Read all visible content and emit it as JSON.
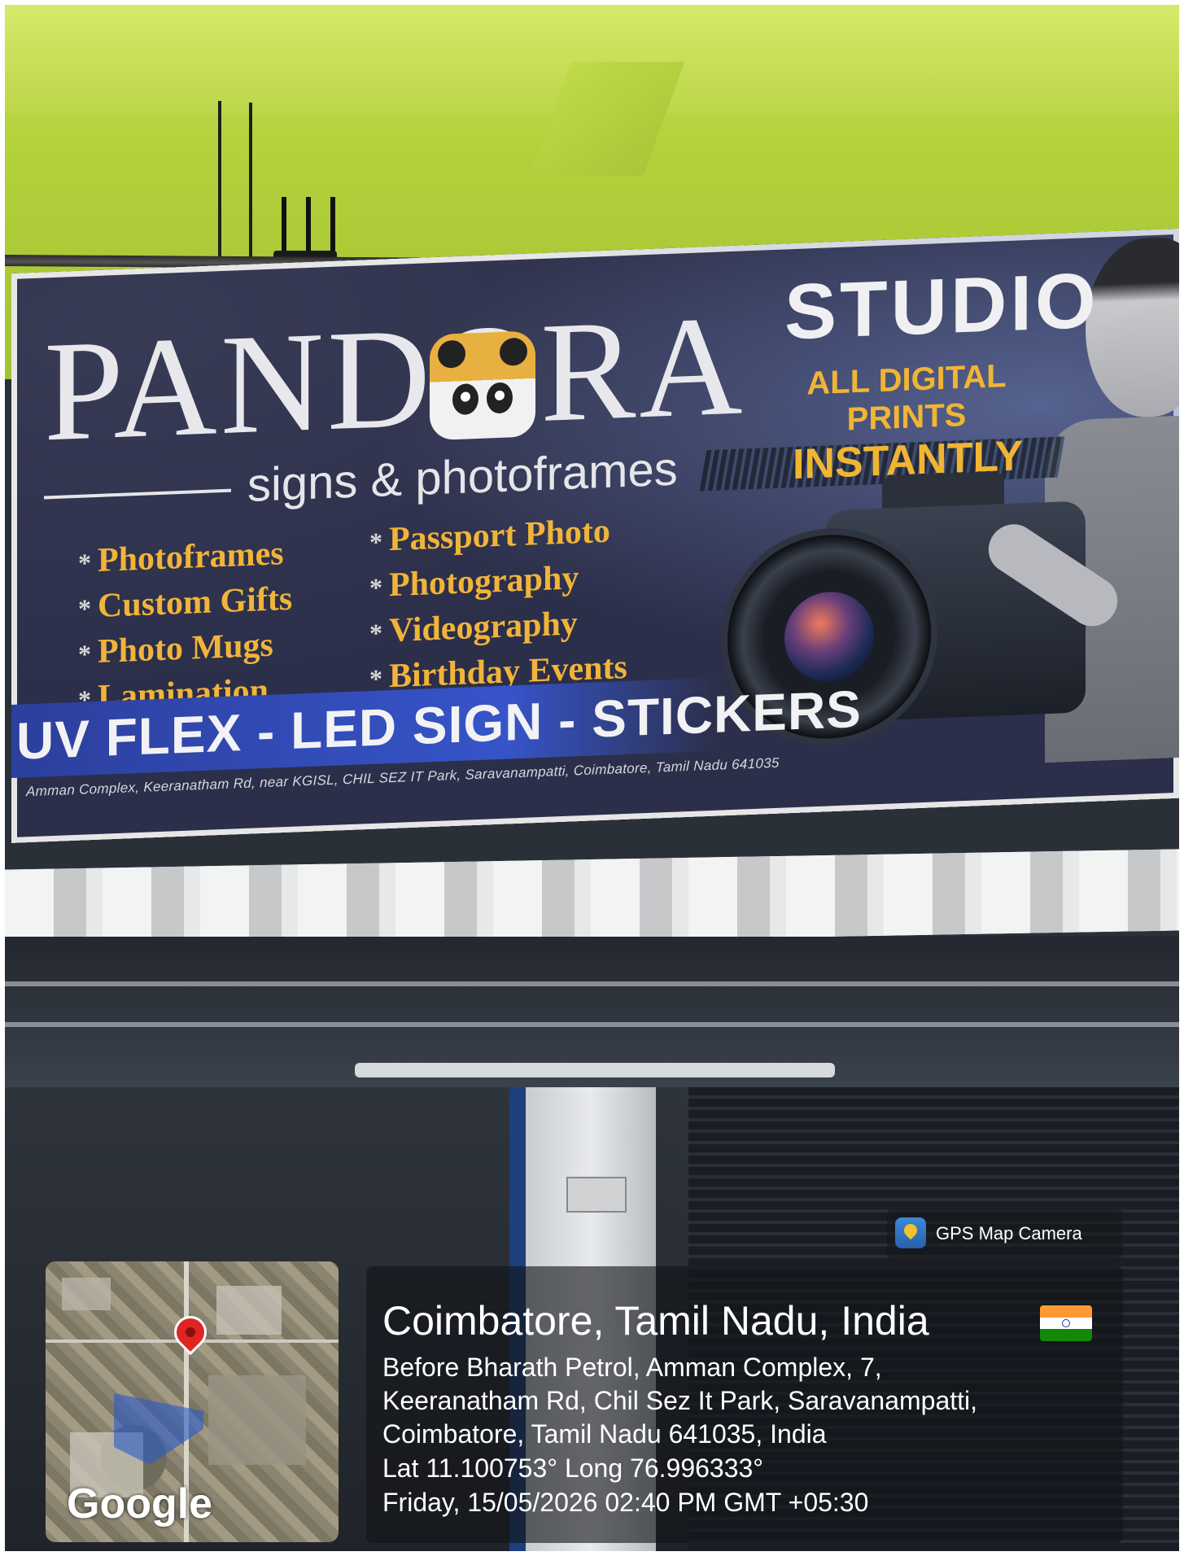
{
  "signboard": {
    "brand": "PANDORA",
    "tagline": "signs & photoframes",
    "studio": "STUDIO",
    "promo": [
      "ALL DIGITAL",
      "PRINTS",
      "INSTANTLY !"
    ],
    "services_left": [
      "Photoframes",
      "Custom Gifts",
      "Photo Mugs",
      "Lamination"
    ],
    "services_right": [
      "Passport Photo",
      "Photography",
      "Videography",
      "Birthday Events"
    ],
    "banner": "UV FLEX - LED SIGN - STICKERS",
    "address": "Amman Complex, Keeranatham Rd, near KGISL, CHIL SEZ IT Park, Saravanampatti, Coimbatore, Tamil Nadu 641035"
  },
  "gps_overlay": {
    "app_name": "GPS Map Camera",
    "city_line": "Coimbatore, Tamil Nadu, India",
    "address_lines": [
      "Before Bharath Petrol, Amman Complex, 7,",
      "Keeranatham Rd, Chil Sez It Park, Saravanampatti,",
      "Coimbatore, Tamil Nadu 641035, India"
    ],
    "coordinates": "Lat 11.100753° Long 76.996333°",
    "datetime": "Friday, 15/05/2026 02:40 PM GMT +05:30",
    "map_attribution": "Google"
  },
  "colors": {
    "wall": "#b3d13b",
    "board": "#2c2f4a",
    "promo_text": "#f0b533",
    "service_text": "#f1b43a",
    "banner_strip": "#3654c9",
    "pin": "#e02424"
  }
}
